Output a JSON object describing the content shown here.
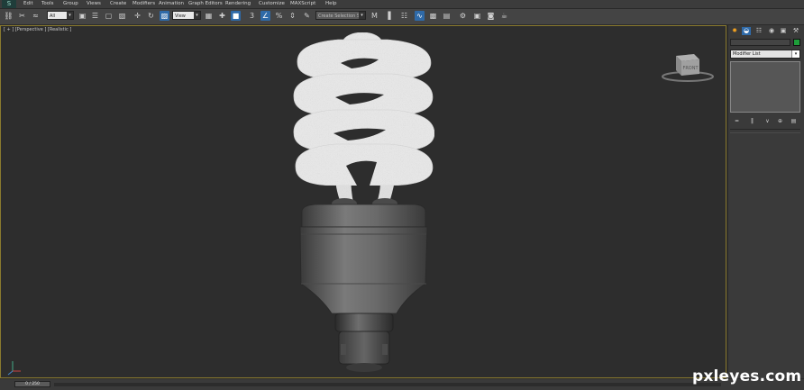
{
  "app": {
    "logo_text": "S"
  },
  "menu": [
    "Edit",
    "Tools",
    "Group",
    "Views",
    "Create",
    "Modifiers",
    "Animation",
    "Graph Editors",
    "Rendering",
    "Customize",
    "MAXScript",
    "Help"
  ],
  "toolbar": {
    "selection_filter": "All",
    "reference_coord": "View",
    "named_selection_placeholder": "Create Selection Set"
  },
  "viewport": {
    "label": "[ + ] [Perspective ] [Realistic ]",
    "viewcube_face": "FRONT"
  },
  "command_panel": {
    "modifier_list": "Modifier List"
  },
  "timeline": {
    "frame_readout": "0 / 250"
  },
  "watermark": "pxleyes.com",
  "colors": {
    "viewport_border": "#8a7a2e",
    "object_color": "#1e9e3a",
    "active_tool": "#2f6aa8"
  },
  "icons": {
    "toolbar": [
      "link-icon",
      "unlink-icon",
      "bind-spacewarp-icon",
      "select-object-icon",
      "select-by-name-icon",
      "rect-selection-icon",
      "window-crossing-icon",
      "move-icon",
      "rotate-icon",
      "scale-icon",
      "pivot-icon",
      "manipulate-icon",
      "keyboard-shortcut-icon",
      "snap-icon",
      "angle-snap-icon",
      "percent-snap-icon",
      "spinner-snap-icon",
      "edit-named-sel-icon",
      "mirror-icon",
      "align-icon",
      "layer-manager-icon",
      "curve-editor-icon",
      "schematic-view-icon",
      "material-editor-icon",
      "render-setup-icon",
      "rendered-frame-icon",
      "render-icon"
    ],
    "command_panel": [
      "create-tab-icon",
      "modify-tab-icon",
      "hierarchy-tab-icon",
      "motion-tab-icon",
      "display-tab-icon",
      "utilities-tab-icon"
    ]
  }
}
